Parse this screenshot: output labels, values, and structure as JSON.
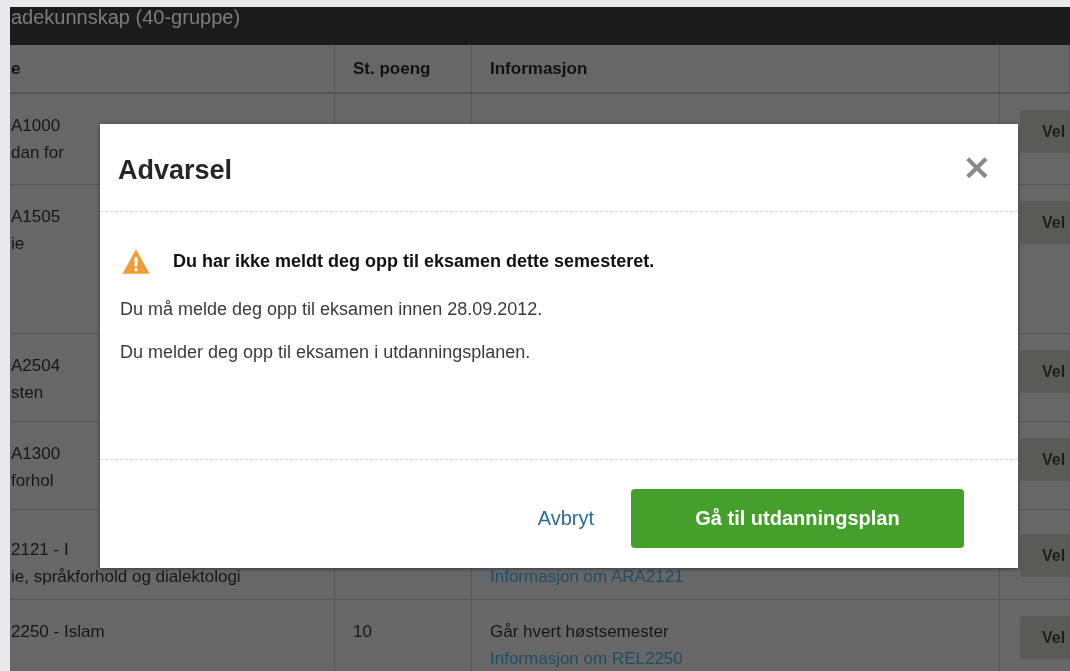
{
  "page_title": "adekunnskap (40-gruppe)",
  "table": {
    "columns": [
      "e",
      "St. poeng",
      "Informasjon"
    ],
    "rows": [
      {
        "course": [
          "A1000",
          "dan for"
        ],
        "button": "Vel"
      },
      {
        "course": [
          "A1505",
          "ie"
        ],
        "button": "Vel"
      },
      {
        "course": [
          "A2504",
          "sten"
        ],
        "button": "Vel"
      },
      {
        "course": [
          "A1300",
          "forhol"
        ],
        "button": "Vel"
      },
      {
        "course": [
          "2121 - I",
          "ie, språkforhold og dialektologi"
        ],
        "info": [
          {
            "kind": "link",
            "text": "Informasjon om ARA2121"
          }
        ],
        "button": "Vel"
      },
      {
        "course": [
          "2250 - Islam"
        ],
        "points": "10",
        "info": [
          {
            "kind": "text",
            "text": "Går hvert høstsemester"
          },
          {
            "kind": "link",
            "text": "Informasjon om REL2250"
          }
        ],
        "button": "Vel"
      }
    ]
  },
  "dialog": {
    "title": "Advarsel",
    "close": "×",
    "warning": "Du har ikke meldt deg opp til eksamen dette semesteret.",
    "paragraphs": [
      "Du må melde deg opp til eksamen innen 28.09.2012.",
      "Du melder deg opp til eksamen i utdanningsplanen."
    ],
    "cancel": "Avbryt",
    "confirm": "Gå til utdanningsplan"
  }
}
